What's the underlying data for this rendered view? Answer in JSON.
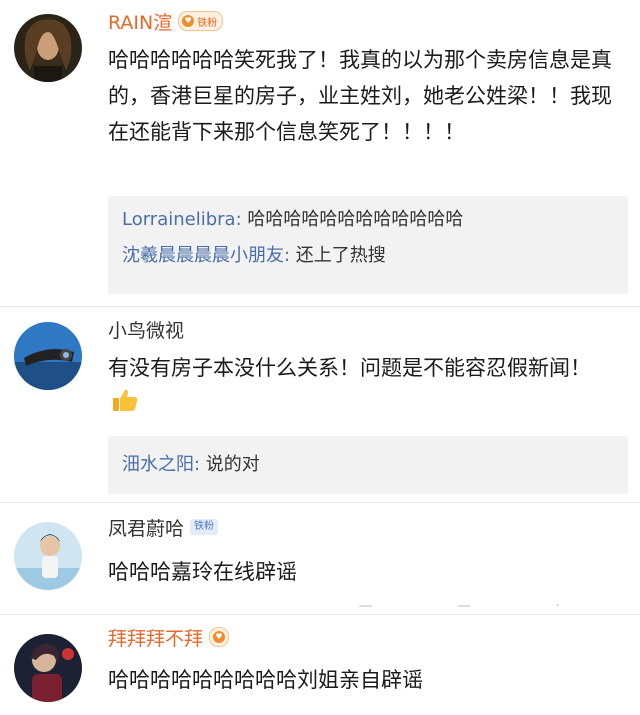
{
  "comments": [
    {
      "user": "RAIN渲",
      "badge": "铁粉",
      "text": "哈哈哈哈哈哈笑死我了！我真的以为那个卖房信息是真的，香港巨星的房子，业主姓刘，她老公姓梁！！我现在还能背下来那个信息笑死了！！！！",
      "replies": [
        {
          "user": "Lorrainelibra",
          "sep": ": ",
          "text": "哈哈哈哈哈哈哈哈哈哈哈哈"
        },
        {
          "user": "沈羲晨晨晨晨小朋友",
          "sep": ": ",
          "text": "还上了热搜"
        }
      ]
    },
    {
      "user": "小鸟微视",
      "text": "有没有房子本没什么关系！问题是不能容忍假新闻！",
      "replies": [
        {
          "user": "沺水之阳",
          "sep": ": ",
          "text": "说的对"
        }
      ]
    },
    {
      "user": "凤君蔚哈",
      "badge": "铁粉",
      "text": "哈哈哈嘉玲在线辟谣"
    },
    {
      "user": "拜拜拜不拜",
      "text": "哈哈哈哈哈哈哈哈哈刘姐亲自辟谣"
    }
  ],
  "colors": {
    "vip_name": "#e8682a",
    "reply_user": "#4a6fa8",
    "reply_bg": "#f2f2f2"
  },
  "icons": [
    "thumbs-up-icon",
    "fan-badge-icon",
    "more-icon"
  ]
}
